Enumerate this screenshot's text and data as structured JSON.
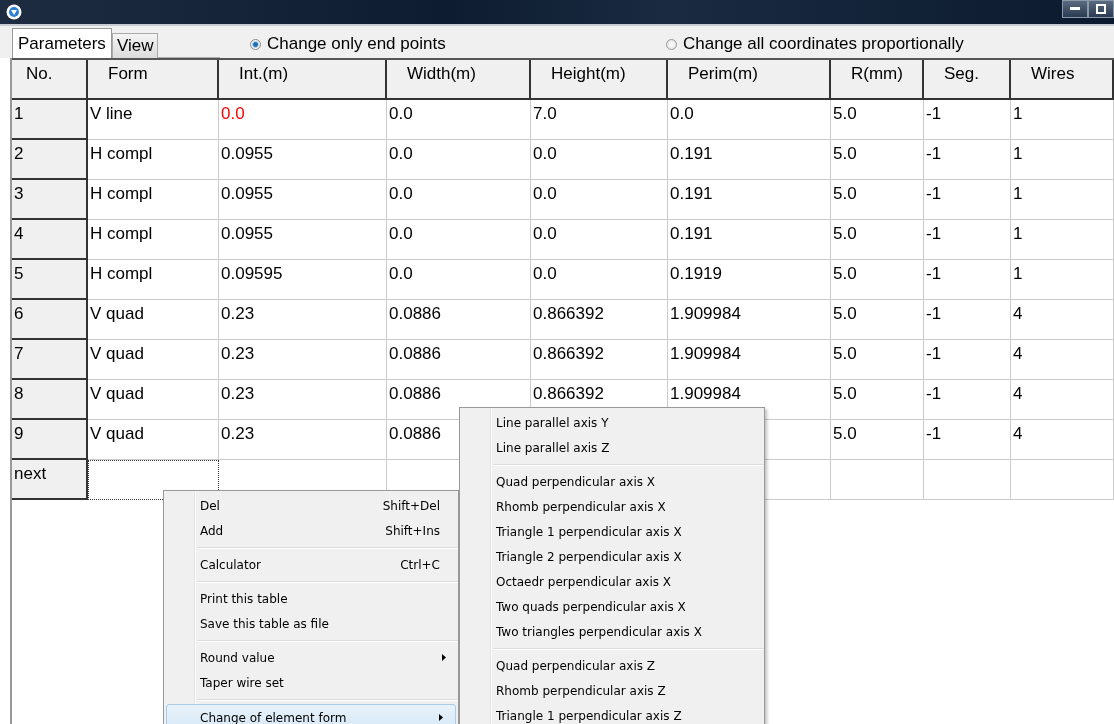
{
  "tabs": [
    {
      "label": "Parameters",
      "selected": true
    },
    {
      "label": "View",
      "selected": false
    }
  ],
  "radios": [
    {
      "label": "Change only end points",
      "selected": true
    },
    {
      "label": "Change all coordinates proportionally",
      "selected": false
    }
  ],
  "table": {
    "columns": [
      "No.",
      "Form",
      "Int.(m)",
      "Width(m)",
      "Height(m)",
      "Perim(m)",
      "R(mm)",
      "Seg.",
      "Wires"
    ],
    "rows": [
      {
        "cells": [
          "1",
          "V line",
          "0.0",
          "0.0",
          "7.0",
          "0.0",
          "5.0",
          "-1",
          "1"
        ],
        "int_invalid": true
      },
      {
        "cells": [
          "2",
          "H compl",
          "0.0955",
          "0.0",
          "0.0",
          "0.191",
          "5.0",
          "-1",
          "1"
        ],
        "int_invalid": false
      },
      {
        "cells": [
          "3",
          "H compl",
          "0.0955",
          "0.0",
          "0.0",
          "0.191",
          "5.0",
          "-1",
          "1"
        ],
        "int_invalid": false
      },
      {
        "cells": [
          "4",
          "H compl",
          "0.0955",
          "0.0",
          "0.0",
          "0.191",
          "5.0",
          "-1",
          "1"
        ],
        "int_invalid": false
      },
      {
        "cells": [
          "5",
          "H compl",
          "0.09595",
          "0.0",
          "0.0",
          "0.1919",
          "5.0",
          "-1",
          "1"
        ],
        "int_invalid": false
      },
      {
        "cells": [
          "6",
          "V quad",
          "0.23",
          "0.0886",
          "0.866392",
          "1.909984",
          "5.0",
          "-1",
          "4"
        ],
        "int_invalid": false
      },
      {
        "cells": [
          "7",
          "V quad",
          "0.23",
          "0.0886",
          "0.866392",
          "1.909984",
          "5.0",
          "-1",
          "4"
        ],
        "int_invalid": false
      },
      {
        "cells": [
          "8",
          "V quad",
          "0.23",
          "0.0886",
          "0.866392",
          "1.909984",
          "5.0",
          "-1",
          "4"
        ],
        "int_invalid": false
      },
      {
        "cells": [
          "9",
          "V quad",
          "0.23",
          "0.0886",
          null,
          null,
          "5.0",
          "-1",
          "4"
        ],
        "int_invalid": false
      }
    ],
    "next_row": {
      "label": "next",
      "form_cell_focused": true
    }
  },
  "context_menu": {
    "groups": [
      [
        {
          "label": "Del",
          "shortcut": "Shift+Del",
          "submenu": false,
          "highlighted": false
        },
        {
          "label": "Add",
          "shortcut": "Shift+Ins",
          "submenu": false,
          "highlighted": false
        }
      ],
      [
        {
          "label": "Calculator",
          "shortcut": "Ctrl+C",
          "submenu": false,
          "highlighted": false
        }
      ],
      [
        {
          "label": "Print this table",
          "submenu": false,
          "highlighted": false
        },
        {
          "label": "Save this table as file",
          "submenu": false,
          "highlighted": false
        }
      ],
      [
        {
          "label": "Round value",
          "submenu": true,
          "highlighted": false
        },
        {
          "label": "Taper wire set",
          "submenu": false,
          "highlighted": false
        }
      ],
      [
        {
          "label": "Change of element form",
          "submenu": true,
          "highlighted": true
        }
      ]
    ]
  },
  "submenu": {
    "groups": [
      [
        {
          "label": "Line parallel axis Y"
        },
        {
          "label": "Line parallel axis Z"
        }
      ],
      [
        {
          "label": "Quad perpendicular axis X"
        },
        {
          "label": "Rhomb perpendicular axis X"
        },
        {
          "label": "Triangle 1 perpendicular axis X"
        },
        {
          "label": "Triangle 2 perpendicular axis X"
        },
        {
          "label": "Octaedr perpendicular axis X"
        },
        {
          "label": "Two quads perpendicular axis X"
        },
        {
          "label": "Two triangles perpendicular axis X"
        }
      ],
      [
        {
          "label": "Quad perpendicular axis Z"
        },
        {
          "label": "Rhomb perpendicular axis Z"
        },
        {
          "label": "Triangle 1 perpendicular axis Z"
        }
      ]
    ]
  }
}
